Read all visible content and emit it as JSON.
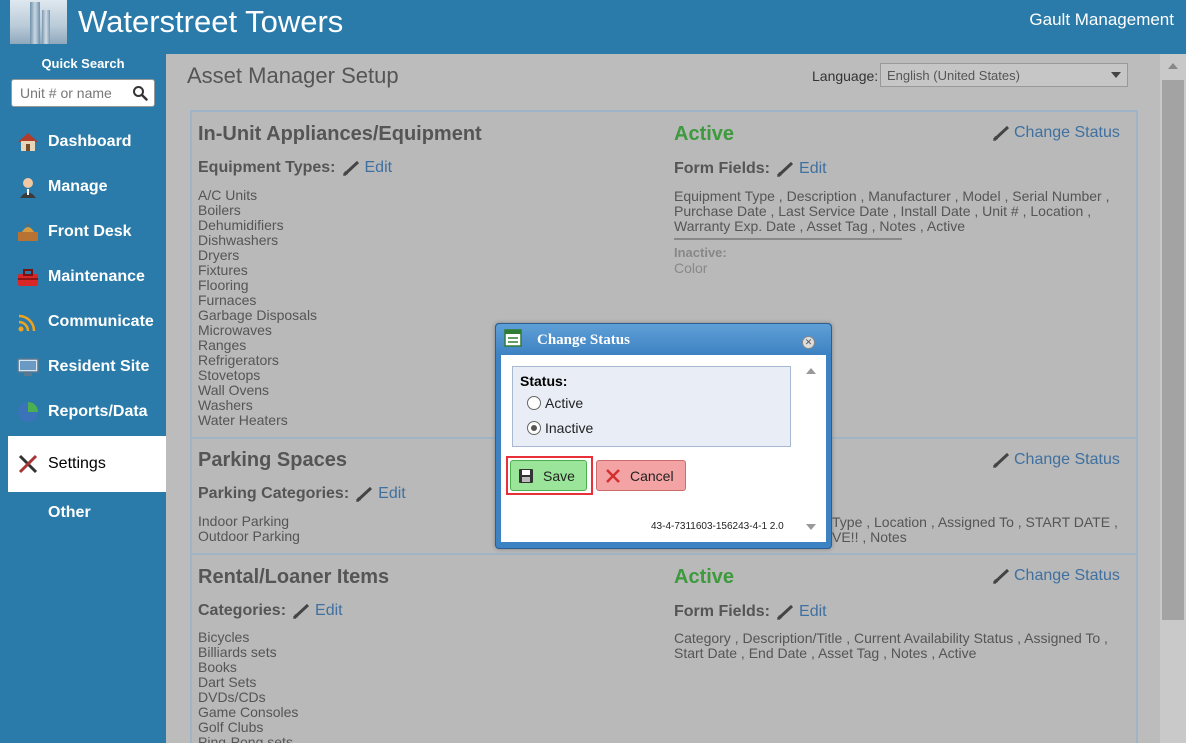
{
  "header": {
    "site_title": "Waterstreet Towers",
    "company_name": "Gault Management"
  },
  "sidebar": {
    "quick_search_label": "Quick Search",
    "quick_search_placeholder": "Unit # or name",
    "items": [
      {
        "label": "Dashboard",
        "icon": "house-icon"
      },
      {
        "label": "Manage",
        "icon": "person-icon"
      },
      {
        "label": "Front Desk",
        "icon": "desk-bell-icon"
      },
      {
        "label": "Maintenance",
        "icon": "toolbox-icon"
      },
      {
        "label": "Communicate",
        "icon": "wifi-icon"
      },
      {
        "label": "Resident Site",
        "icon": "monitor-icon"
      },
      {
        "label": "Reports/Data",
        "icon": "pie-chart-icon"
      },
      {
        "label": "Settings",
        "icon": "tools-icon",
        "active": true
      },
      {
        "label": "Other",
        "icon": ""
      }
    ]
  },
  "main": {
    "page_title": "Asset Manager Setup",
    "language_label": "Language:",
    "language_value": "English (United States)"
  },
  "sections": [
    {
      "title": "In-Unit Appliances/Equipment",
      "status": "Active",
      "change_status": "Change Status",
      "list_heading": "Equipment Types:",
      "edit_label": "Edit",
      "items": [
        "A/C Units",
        "Boilers",
        "Dehumidifiers",
        "Dishwashers",
        "Dryers",
        "Fixtures",
        "Flooring",
        "Furnaces",
        "Garbage Disposals",
        "Microwaves",
        "Ranges",
        "Refrigerators",
        "Stovetops",
        "Wall Ovens",
        "Washers",
        "Water Heaters"
      ],
      "form_fields_heading": "Form Fields:",
      "form_fields_edit": "Edit",
      "form_fields_text": "Equipment Type , Description , Manufacturer , Model , Serial Number , Purchase Date , Last Service Date , Install Date , Unit # , Location , Warranty Exp. Date , Asset Tag , Notes , Active",
      "inactive_heading": "Inactive:",
      "inactive_text": "Color"
    },
    {
      "title": "Parking Spaces",
      "change_status": "Change Status",
      "list_heading": "Parking Categories:",
      "edit_label": "Edit",
      "items": [
        "Indoor Parking",
        "Outdoor Parking"
      ],
      "form_fields_line1": "Type , Location , Assigned To , START DATE ,",
      "form_fields_line2": "VE!! , Notes"
    },
    {
      "title": "Rental/Loaner Items",
      "status": "Active",
      "change_status": "Change Status",
      "list_heading": "Categories:",
      "edit_label": "Edit",
      "items": [
        "Bicycles",
        "Billiards sets",
        "Books",
        "Dart Sets",
        "DVDs/CDs",
        "Game Consoles",
        "Golf Clubs",
        "Ping-Pong sets"
      ],
      "form_fields_heading": "Form Fields:",
      "form_fields_edit": "Edit",
      "form_fields_text": "Category , Description/Title , Current Availability Status , Assigned To , Start Date , End Date , Asset Tag , Notes , Active"
    }
  ],
  "dialog": {
    "title": "Change Status",
    "status_label": "Status:",
    "options": [
      {
        "label": "Active",
        "checked": false
      },
      {
        "label": "Inactive",
        "checked": true
      }
    ],
    "save_label": "Save",
    "cancel_label": "Cancel",
    "version": "43-4-7311603-156243-4-1 2.0"
  },
  "colors": {
    "header_bg": "#2a7ba9",
    "active_green": "#3d9a3d",
    "link_blue": "#3f70a0",
    "save_green": "#9ae59a",
    "cancel_red": "#f3a3a3",
    "highlight_red": "#e8303a"
  }
}
